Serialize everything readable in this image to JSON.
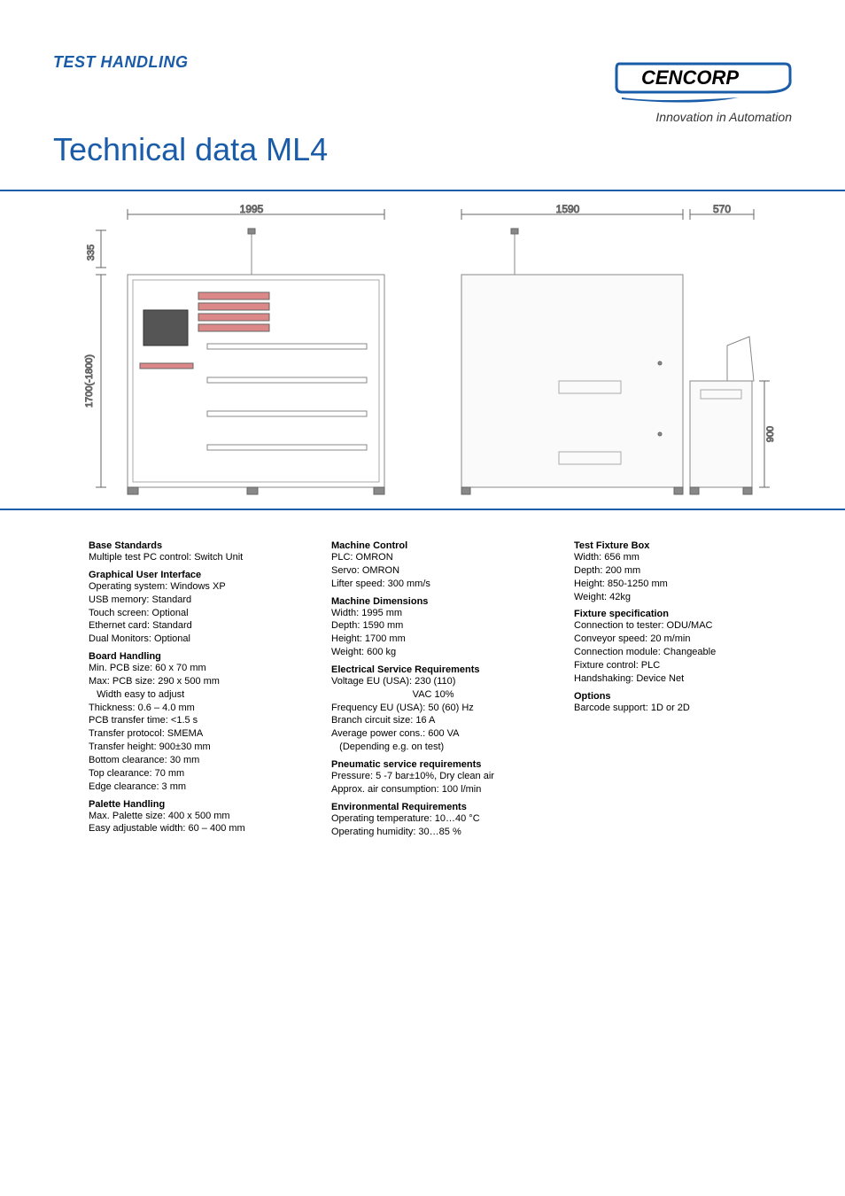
{
  "header": {
    "category": "TEST HANDLING",
    "title": "Technical data ML4",
    "brand_name": "CENCORP",
    "tagline": "Innovation in Automation"
  },
  "drawings": {
    "front": {
      "dim_top": "1995",
      "dim_left_top": "335",
      "dim_left_main": "1700(-1800)"
    },
    "side": {
      "dim_top_a": "1590",
      "dim_top_b": "570",
      "dim_right": "900"
    }
  },
  "specs": {
    "col1": [
      {
        "title": "Base Standards",
        "lines": [
          "Multiple test PC control: Switch Unit"
        ]
      },
      {
        "title": "Graphical User Interface",
        "lines": [
          "Operating system: Windows XP",
          "USB memory: Standard",
          "Touch screen: Optional",
          "Ethernet card: Standard",
          "Dual Monitors: Optional"
        ]
      },
      {
        "title": "Board Handling",
        "lines": [
          "Min. PCB size: 60 x 70 mm",
          "Max: PCB size: 290 x 500 mm",
          "   Width easy to adjust",
          "Thickness: 0.6 – 4.0 mm",
          "PCB transfer time: <1.5 s",
          "Transfer protocol: SMEMA",
          "Transfer height: 900±30 mm",
          "Bottom clearance: 30 mm",
          "Top clearance: 70 mm",
          "Edge clearance: 3 mm"
        ]
      },
      {
        "title": "Palette Handling",
        "lines": [
          "Max. Palette size: 400 x 500 mm",
          "Easy adjustable width: 60 – 400 mm"
        ]
      }
    ],
    "col2": [
      {
        "title": "Machine Control",
        "lines": [
          "PLC: OMRON",
          "Servo: OMRON",
          "Lifter speed: 300 mm/s"
        ]
      },
      {
        "title": "Machine Dimensions",
        "lines": [
          "Width: 1995 mm",
          "Depth: 1590 mm",
          "Height: 1700 mm",
          "Weight: 600 kg"
        ]
      },
      {
        "title": "Electrical Service Requirements",
        "lines": [
          "Voltage EU (USA): 230 (110)",
          "                              VAC 10%",
          "Frequency EU (USA): 50 (60) Hz",
          "Branch circuit size: 16 A",
          "Average power cons.: 600 VA",
          "   (Depending e.g. on test)"
        ]
      },
      {
        "title": "Pneumatic service requirements",
        "lines": [
          "Pressure: 5 -7 bar±10%, Dry clean air",
          "Approx. air consumption: 100 l/min"
        ]
      },
      {
        "title": "Environmental Requirements",
        "lines": [
          "Operating temperature: 10…40 °C",
          "Operating humidity: 30…85 %"
        ]
      }
    ],
    "col3": [
      {
        "title": "Test Fixture Box",
        "lines": [
          "Width: 656 mm",
          "Depth: 200 mm",
          "Height: 850-1250 mm",
          "Weight: 42kg"
        ]
      },
      {
        "title": "Fixture specification",
        "lines": [
          "Connection to tester: ODU/MAC",
          "Conveyor speed: 20 m/min",
          "Connection module: Changeable",
          "Fixture control: PLC",
          "Handshaking: Device Net"
        ]
      },
      {
        "title": "Options",
        "lines": [
          "Barcode support: 1D or 2D"
        ]
      }
    ]
  }
}
